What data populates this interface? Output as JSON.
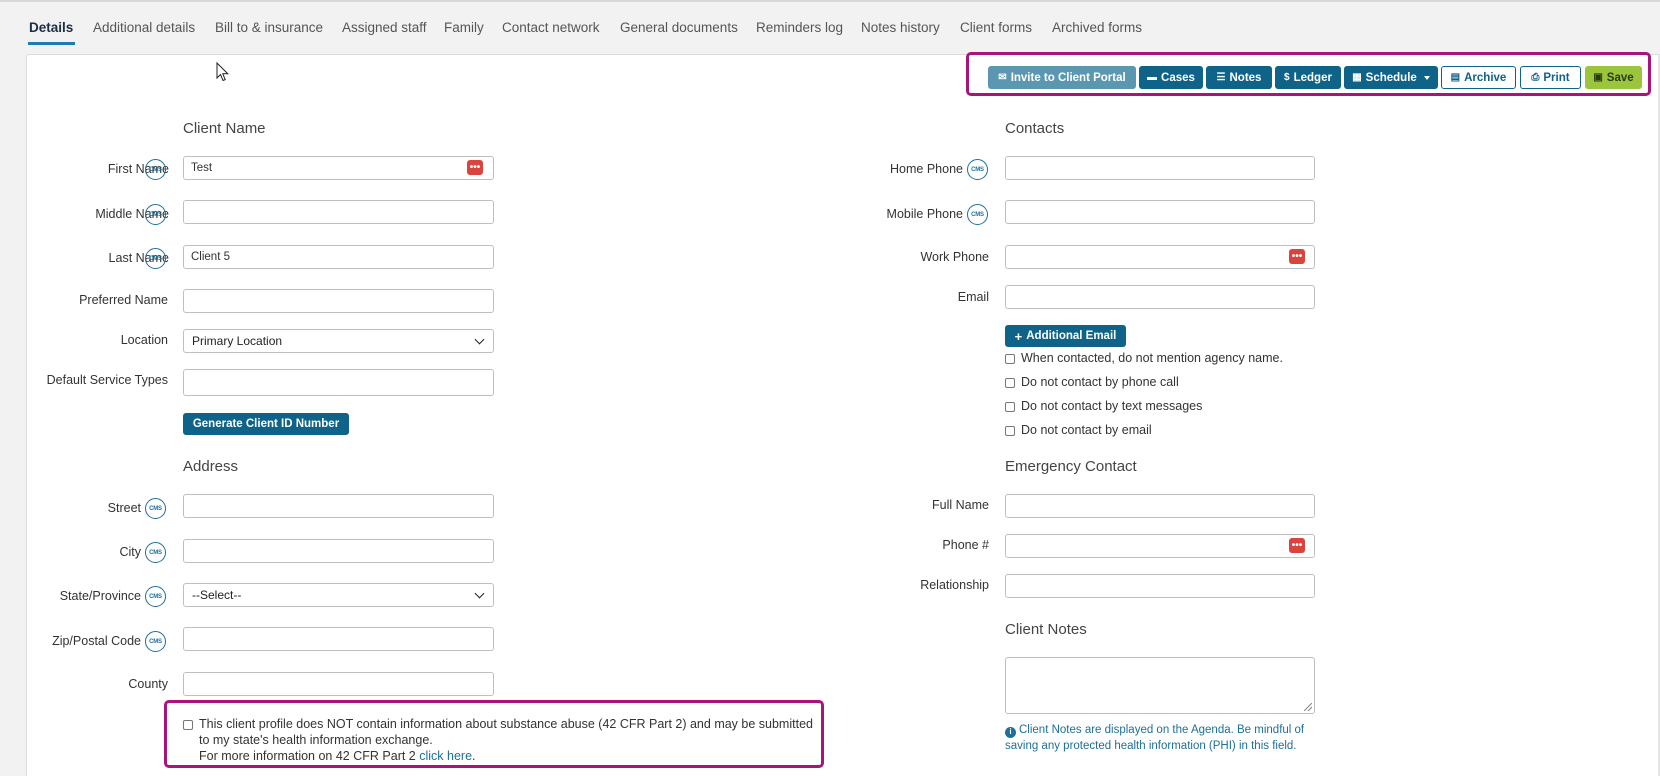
{
  "tabs": [
    {
      "label": "Details",
      "active": true
    },
    {
      "label": "Additional details"
    },
    {
      "label": "Bill to & insurance"
    },
    {
      "label": "Assigned staff"
    },
    {
      "label": "Family"
    },
    {
      "label": "Contact network"
    },
    {
      "label": "General documents"
    },
    {
      "label": "Reminders log"
    },
    {
      "label": "Notes history"
    },
    {
      "label": "Client forms"
    },
    {
      "label": "Archived forms"
    }
  ],
  "toolbar": {
    "invite": "Invite to Client Portal",
    "cases": "Cases",
    "notes": "Notes",
    "ledger": "Ledger",
    "schedule": "Schedule",
    "archive": "Archive",
    "print": "Print",
    "save": "Save"
  },
  "client_name": {
    "section_title": "Client Name",
    "first_name_label": "First Name",
    "first_name_value": "Test",
    "middle_name_label": "Middle Name",
    "middle_name_value": "",
    "last_name_label": "Last Name",
    "last_name_value": "Client 5",
    "preferred_name_label": "Preferred Name",
    "preferred_name_value": "",
    "location_label": "Location",
    "location_value": "Primary Location",
    "service_types_label": "Default Service Types",
    "generate_id_button": "Generate Client ID Number",
    "cms_badge": "CMS"
  },
  "address": {
    "section_title": "Address",
    "street_label": "Street",
    "city_label": "City",
    "state_label": "State/Province",
    "state_value": "--Select--",
    "zip_label": "Zip/Postal Code",
    "county_label": "County"
  },
  "contacts": {
    "section_title": "Contacts",
    "home_phone_label": "Home Phone",
    "mobile_phone_label": "Mobile Phone",
    "work_phone_label": "Work Phone",
    "email_label": "Email",
    "additional_email_button": "Additional Email",
    "checkboxes": [
      "When contacted, do not mention agency name.",
      "Do not contact by phone call",
      "Do not contact by text messages",
      "Do not contact by email"
    ]
  },
  "emergency_contact": {
    "section_title": "Emergency Contact",
    "full_name_label": "Full Name",
    "phone_label": "Phone #",
    "relationship_label": "Relationship"
  },
  "client_notes": {
    "section_title": "Client Notes",
    "info": "Client Notes are displayed on the Agenda. Be mindful of saving any protected health information (PHI) in this field."
  },
  "consent": {
    "line1": "This client profile does NOT contain information about substance abuse (42 CFR Part 2) and may be submitted to my state's health information exchange.",
    "line2_prefix": "For more information on 42 CFR Part 2 ",
    "link": "click here",
    "line2_suffix": "."
  },
  "colors": {
    "highlight": "#a8147b",
    "primary": "#0f6388",
    "save": "#9bc53d",
    "danger": "#d9453c"
  }
}
